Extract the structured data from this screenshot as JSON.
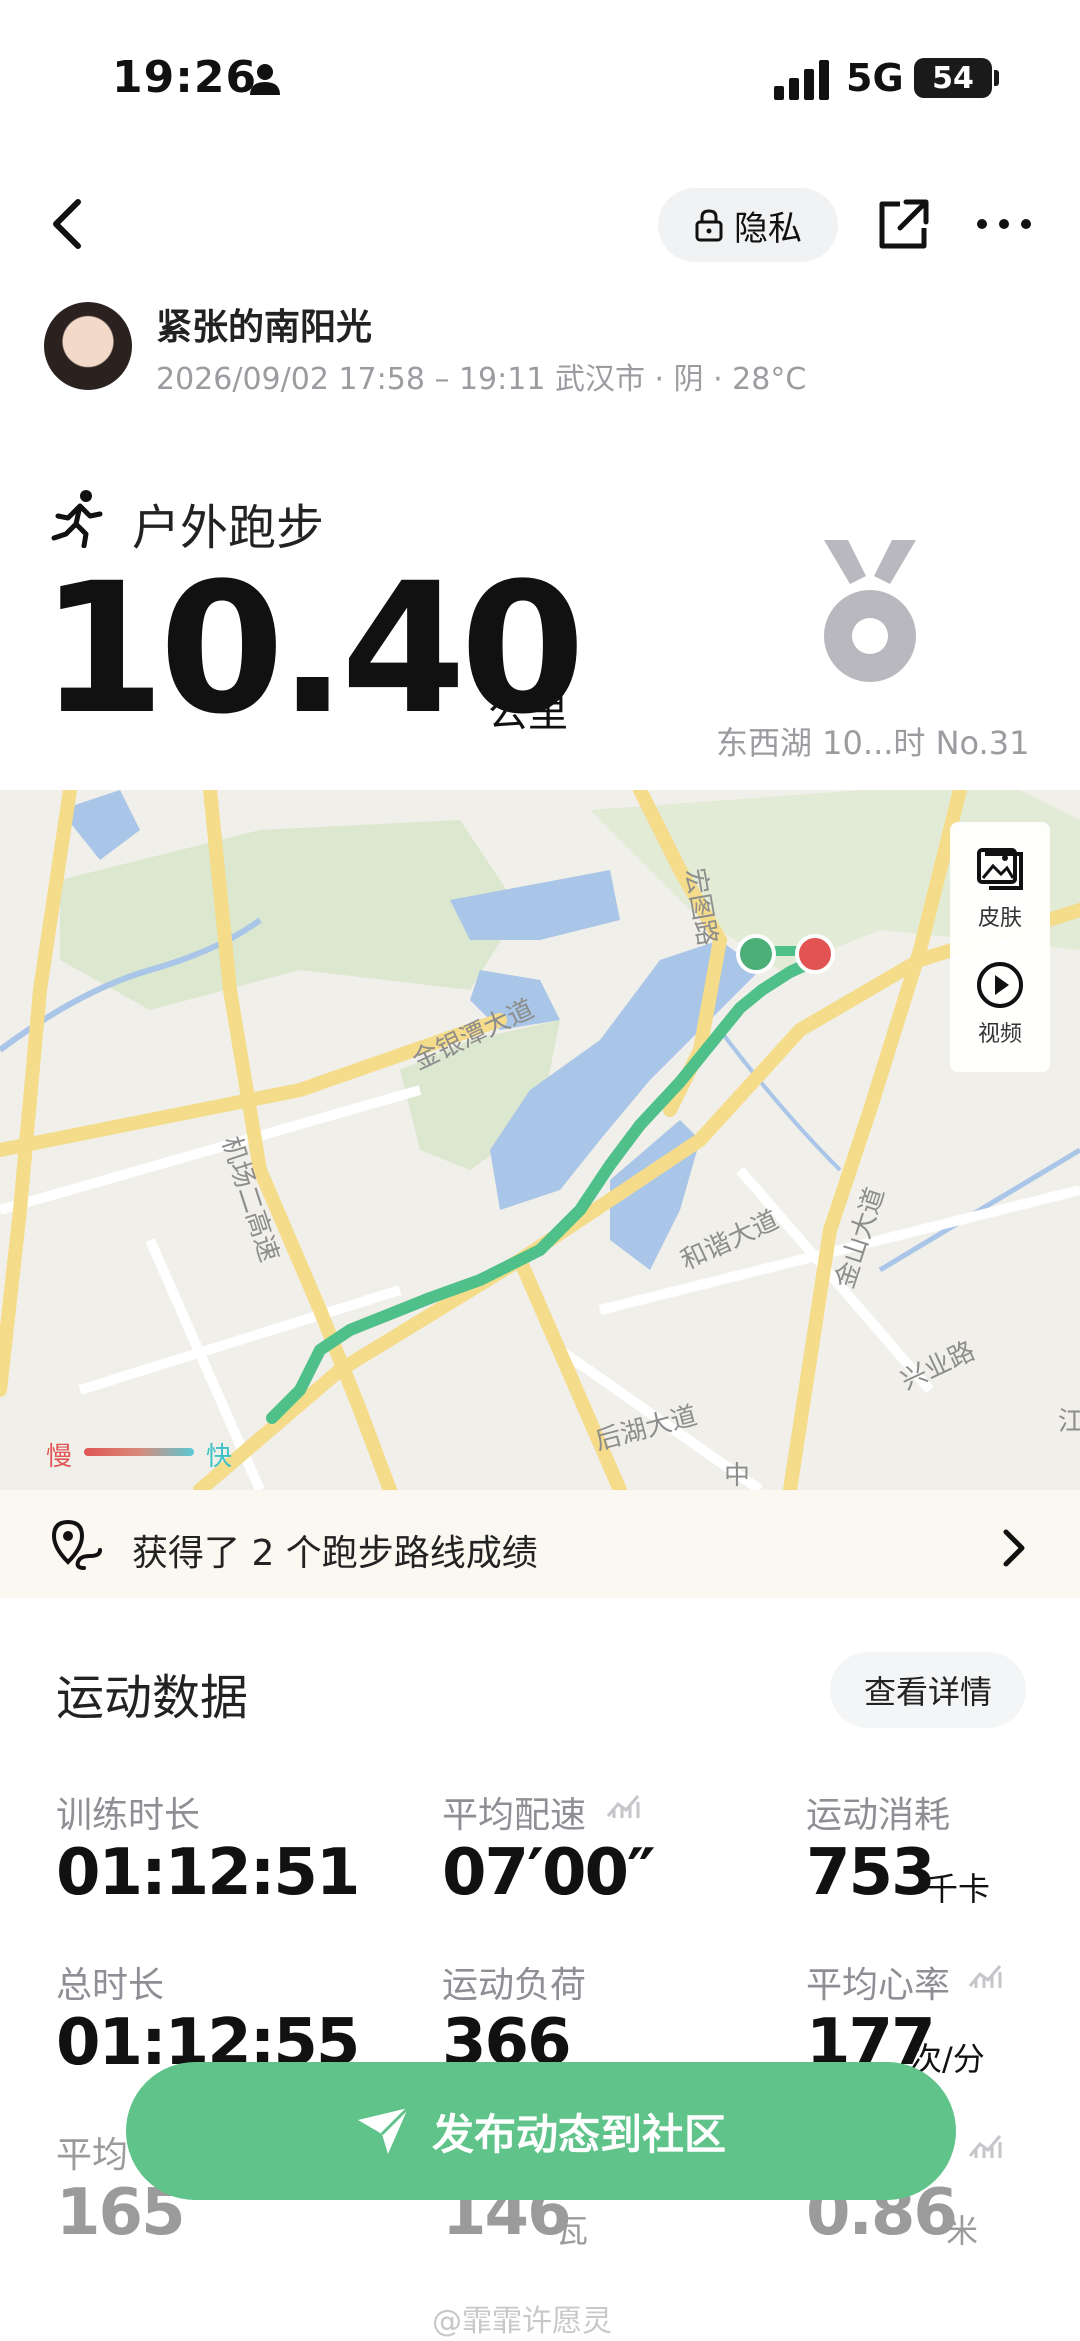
{
  "status_bar": {
    "time": "19:26",
    "network": "5G",
    "battery": "54"
  },
  "header": {
    "privacy_label": "隐私"
  },
  "user": {
    "name": "紧张的南阳光",
    "meta": "2026/09/02 17:58 – 19:11 武汉市 · 阴 · 28°C"
  },
  "activity": {
    "type": "户外跑步",
    "distance": "10.40",
    "unit": "公里",
    "medal_caption": "东西湖 10...时 No.31"
  },
  "map": {
    "labels": [
      "宏图路",
      "金银潭大道",
      "机场二高速",
      "和谐大道",
      "金山大道",
      "后湖大道",
      "兴业路",
      "中",
      "江"
    ],
    "side_skin": "皮肤",
    "side_video": "视频",
    "legend_slow": "慢",
    "legend_fast": "快"
  },
  "achievement": {
    "text": "获得了 2 个跑步路线成绩"
  },
  "stats": {
    "title": "运动数据",
    "details_label": "查看详情",
    "items": [
      {
        "label": "训练时长",
        "value": "01:12:51",
        "unit": ""
      },
      {
        "label": "平均配速",
        "value": "07′00″",
        "unit": ""
      },
      {
        "label": "运动消耗",
        "value": "753",
        "unit": "千卡"
      },
      {
        "label": "总时长",
        "value": "01:12:55",
        "unit": ""
      },
      {
        "label": "运动负荷",
        "value": "366",
        "unit": ""
      },
      {
        "label": "平均心率",
        "value": "177",
        "unit": "次/分"
      },
      {
        "label": "平均",
        "value": "165",
        "unit": ""
      },
      {
        "label": "",
        "value": "146",
        "unit": "瓦"
      },
      {
        "label": "",
        "value": "0.86",
        "unit": "米"
      }
    ]
  },
  "publish": {
    "label": "发布动态到社区"
  },
  "watermark": "@霏霏许愿灵",
  "colors": {
    "accent_green": "#5fc38a",
    "route_green": "#4fc08a",
    "start_dot": "#4caf77",
    "end_dot": "#e25454"
  }
}
